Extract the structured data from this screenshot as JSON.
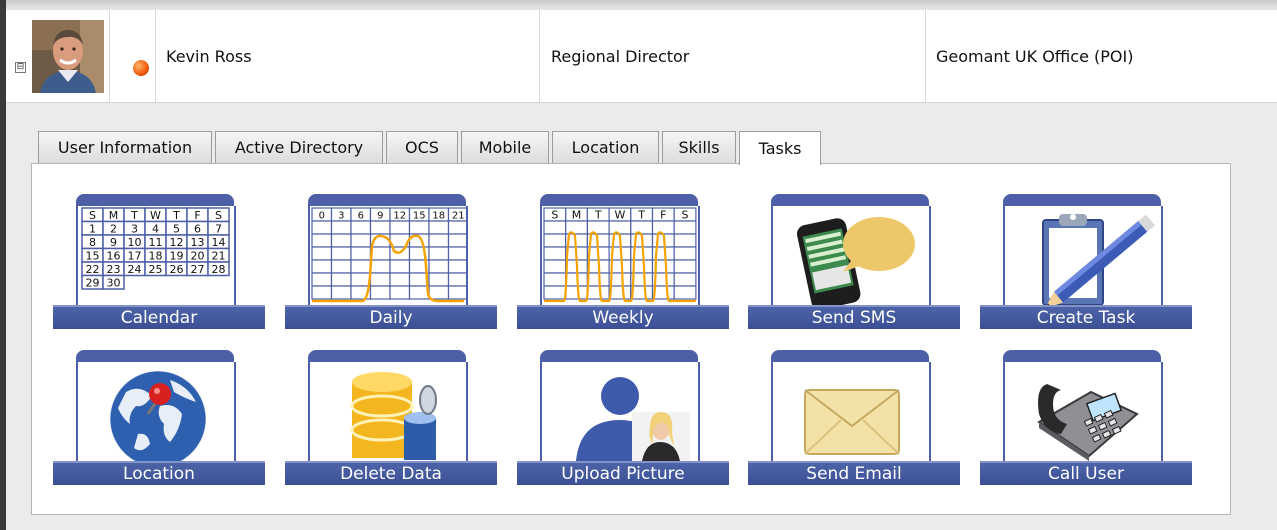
{
  "user": {
    "name": "Kevin Ross",
    "title": "Regional Director",
    "office": "Geomant UK Office (POI)",
    "status_color": "#f05a0a",
    "expander": "⊟"
  },
  "tabs": [
    {
      "label": "User Information"
    },
    {
      "label": "Active Directory"
    },
    {
      "label": "OCS"
    },
    {
      "label": "Mobile"
    },
    {
      "label": "Location"
    },
    {
      "label": "Skills"
    },
    {
      "label": "Tasks"
    }
  ],
  "active_tab": "Tasks",
  "calendar": {
    "headers": [
      "S",
      "M",
      "T",
      "W",
      "T",
      "F",
      "S"
    ],
    "rows": [
      [
        "",
        "",
        "",
        "",
        "",
        "",
        ""
      ],
      [
        "1",
        "2",
        "3",
        "4",
        "5",
        "6",
        "7"
      ],
      [
        "8",
        "9",
        "10",
        "11",
        "12",
        "13",
        "14"
      ],
      [
        "15",
        "16",
        "17",
        "18",
        "19",
        "20",
        "21"
      ],
      [
        "22",
        "23",
        "24",
        "25",
        "26",
        "27",
        "28"
      ],
      [
        "29",
        "30",
        "",
        "",
        "",
        "",
        ""
      ]
    ]
  },
  "daily_hours": [
    "0",
    "3",
    "6",
    "9",
    "12",
    "15",
    "18",
    "21"
  ],
  "weekly_headers": [
    "S",
    "M",
    "T",
    "W",
    "T",
    "F",
    "S"
  ],
  "tasks": [
    {
      "label": "Calendar",
      "icon": "calendar-icon"
    },
    {
      "label": "Daily",
      "icon": "daily-chart-icon"
    },
    {
      "label": "Weekly",
      "icon": "weekly-chart-icon"
    },
    {
      "label": "Send SMS",
      "icon": "phone-sms-icon"
    },
    {
      "label": "Create Task",
      "icon": "clipboard-pencil-icon"
    },
    {
      "label": "Location",
      "icon": "globe-pin-icon"
    },
    {
      "label": "Delete Data",
      "icon": "database-trash-icon"
    },
    {
      "label": "Upload Picture",
      "icon": "person-picture-icon"
    },
    {
      "label": "Send Email",
      "icon": "envelope-icon"
    },
    {
      "label": "Call User",
      "icon": "desk-phone-icon"
    }
  ],
  "colors": {
    "accent": "#4d5fa6",
    "chart_line": "#f5a300"
  }
}
